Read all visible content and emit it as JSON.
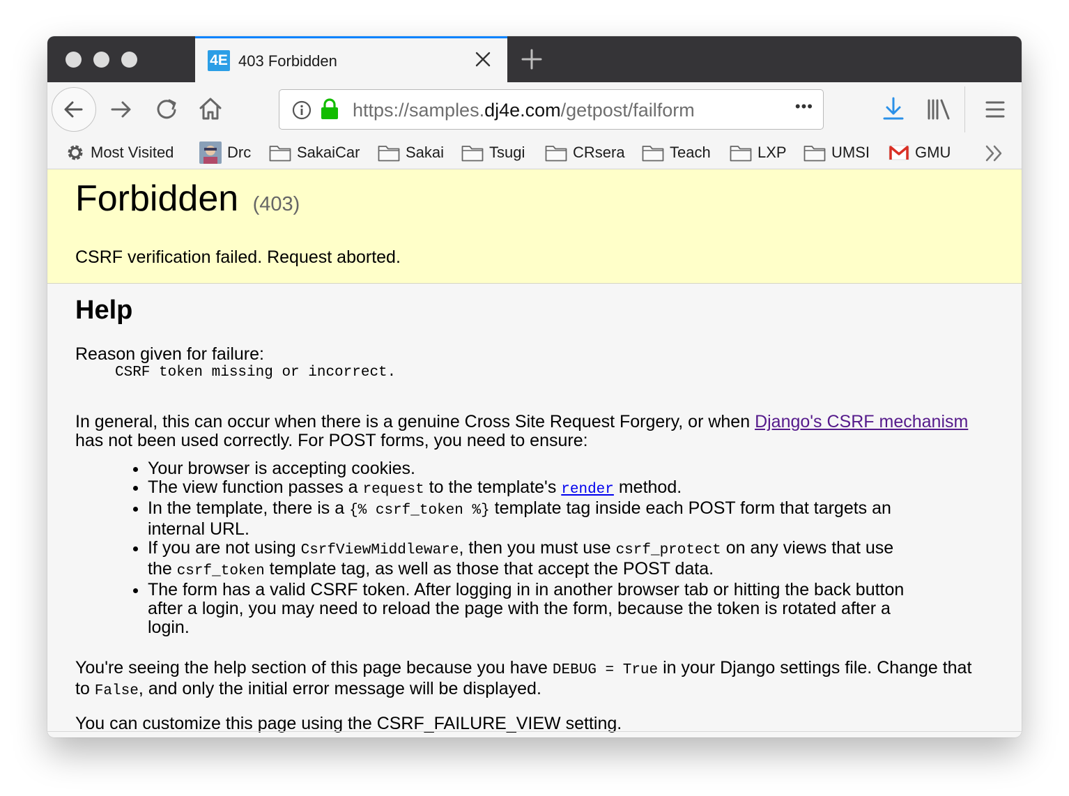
{
  "tab": {
    "favicon": "4E",
    "title": "403 Forbidden",
    "close_icon": "close-icon",
    "new_tab_icon": "plus-icon"
  },
  "toolbar": {
    "url_scheme": "https://samples.",
    "url_host": "dj4e.com",
    "url_path": "/getpost/failform",
    "more_label": "•••"
  },
  "bookmarks": [
    {
      "label": "Most Visited",
      "icon": "gear-icon"
    },
    {
      "label": "Drc",
      "icon": "avatar-icon"
    },
    {
      "label": "SakaiCar",
      "icon": "folder-icon"
    },
    {
      "label": "Sakai",
      "icon": "folder-icon"
    },
    {
      "label": "Tsugi",
      "icon": "folder-icon"
    },
    {
      "label": "CRsera",
      "icon": "folder-icon"
    },
    {
      "label": "Teach",
      "icon": "folder-icon"
    },
    {
      "label": "LXP",
      "icon": "folder-icon"
    },
    {
      "label": "UMSI",
      "icon": "folder-icon"
    },
    {
      "label": "GMU",
      "icon": "gmail-icon"
    }
  ],
  "summary": {
    "title": "Forbidden",
    "code": "(403)",
    "message": "CSRF verification failed. Request aborted."
  },
  "help": {
    "heading": "Help",
    "reason_label": "Reason given for failure:",
    "reason_detail": "CSRF token missing or incorrect.",
    "intro_before": "In general, this can occur when there is a genuine Cross Site Request Forgery, or when ",
    "intro_link": "Django's CSRF mechanism",
    "intro_after": " has not been used correctly. For POST forms, you need to ensure:",
    "b1": "Your browser is accepting cookies.",
    "b2_a": "The view function passes a ",
    "b2_code": "request",
    "b2_b": " to the template's ",
    "b2_link": "render",
    "b2_c": " method.",
    "b3_a": "In the template, there is a ",
    "b3_code": "{% csrf_token %}",
    "b3_b": " template tag inside each POST form that targets an internal URL.",
    "b4_a": "If you are not using ",
    "b4_code1": "CsrfViewMiddleware",
    "b4_b": ", then you must use ",
    "b4_code2": "csrf_protect",
    "b4_c": " on any views that use the ",
    "b4_code3": "csrf_token",
    "b4_d": " template tag, as well as those that accept the POST data.",
    "b5": "The form has a valid CSRF token. After logging in in another browser tab or hitting the back button after a login, you may need to reload the page with the form, because the token is rotated after a login.",
    "debug_a": "You're seeing the help section of this page because you have ",
    "debug_code1": "DEBUG = True",
    "debug_b": " in your Django settings file. Change that to ",
    "debug_code2": "False",
    "debug_c": ", and only the initial error message will be displayed.",
    "customize": "You can customize this page using the CSRF_FAILURE_VIEW setting."
  }
}
